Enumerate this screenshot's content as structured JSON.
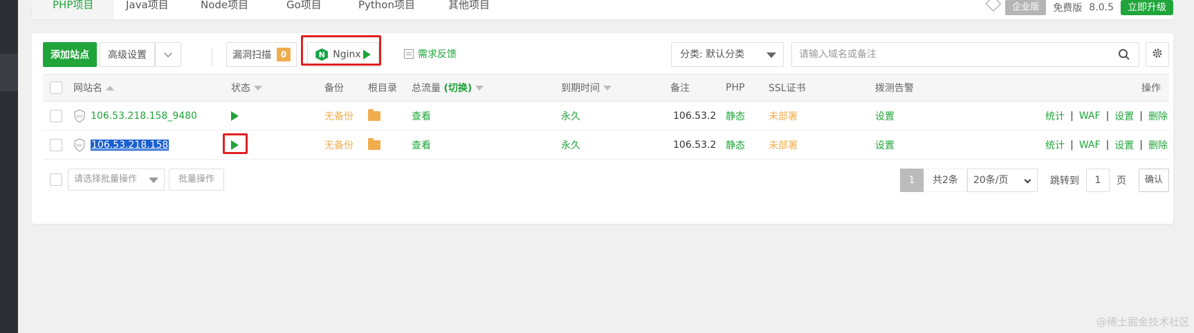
{
  "colors": {
    "accent": "#20a53a",
    "warning": "#f0ad4e",
    "highlight": "#e02020"
  },
  "top_tabs": [
    "PHP项目",
    "Java项目",
    "Node项目",
    "Go项目",
    "Python项目",
    "其他项目"
  ],
  "topbar_right": {
    "edition_badge": "企业版",
    "free_label": "免费版",
    "version": "8.0.5",
    "upgrade": "立即升级"
  },
  "toolbar": {
    "add_site": "添加站点",
    "advanced": "高级设置",
    "vuln_scan": "漏洞扫描",
    "vuln_count": "0",
    "nginx": "Nginx",
    "feedback": "需求反馈",
    "category": "分类: 默认分类",
    "search_placeholder": "请输入域名或备注"
  },
  "table": {
    "headers": {
      "name": "网站名",
      "status": "状态",
      "backup": "备份",
      "root": "根目录",
      "traffic": "总流量",
      "traffic_toggle": "(切换)",
      "expire": "到期时间",
      "note": "备注",
      "php": "PHP",
      "ssl": "SSL证书",
      "probe": "拨测告警",
      "actions": "操作"
    },
    "rows": [
      {
        "name": "106.53.218.158_9480",
        "backup": "无备份",
        "view": "查看",
        "expire": "永久",
        "note": "106.53.2",
        "php": "静态",
        "ssl": "未部署",
        "probe": "设置",
        "a1": "统计",
        "a2": "WAF",
        "a3": "设置",
        "a4": "删除"
      },
      {
        "name": "106.53.218.158",
        "backup": "无备份",
        "view": "查看",
        "expire": "永久",
        "note": "106.53.2",
        "php": "静态",
        "ssl": "未部署",
        "probe": "设置",
        "a1": "统计",
        "a2": "WAF",
        "a3": "设置",
        "a4": "删除"
      }
    ]
  },
  "footer": {
    "batch_placeholder": "请选择批量操作",
    "batch_button": "批量操作",
    "page": "1",
    "total": "共2条",
    "page_size": "20条/页",
    "jump_label": "跳转到",
    "jump_value": "1",
    "page_unit": "页",
    "confirm": "确认"
  },
  "separator": "|",
  "watermark": "@稀土掘金技术社区"
}
